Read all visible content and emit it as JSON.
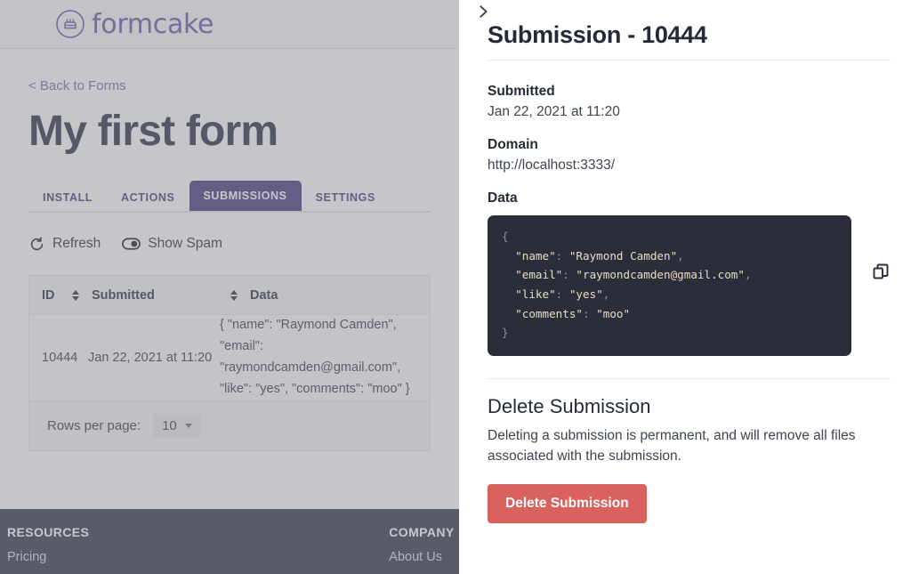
{
  "brand": {
    "name": "formcake",
    "logo_icon": "cake-circle-icon",
    "color": "#6b5ca5"
  },
  "left": {
    "back_link": "< Back to Forms",
    "page_title": "My first form",
    "tabs": [
      {
        "label": "INSTALL",
        "active": false
      },
      {
        "label": "ACTIONS",
        "active": false
      },
      {
        "label": "SUBMISSIONS",
        "active": true
      },
      {
        "label": "SETTINGS",
        "active": false
      }
    ],
    "toolbar": {
      "refresh_label": "Refresh",
      "refresh_icon": "refresh-icon",
      "spam_label": "Show Spam",
      "spam_icon": "toggle-switch-icon"
    },
    "table": {
      "columns": [
        "ID",
        "Submitted",
        "Data"
      ],
      "rows": [
        {
          "id": "10444",
          "submitted": "Jan 22, 2021 at 11:20",
          "data": "{ \"name\": \"Raymond Camden\", \"email\": \"raymondcamden@gmail.com\", \"like\": \"yes\", \"comments\": \"moo\" }"
        }
      ],
      "rows_per_page_label": "Rows per page:",
      "rows_per_page_value": "10"
    },
    "footer": {
      "columns": [
        {
          "title": "RESOURCES",
          "links": [
            "Pricing"
          ]
        },
        {
          "title": "COMPANY",
          "links": [
            "About Us"
          ]
        }
      ]
    }
  },
  "drawer": {
    "close_icon": "chevron-right-icon",
    "title": "Submission - 10444",
    "submitted_label": "Submitted",
    "submitted_value": "Jan 22, 2021 at 11:20",
    "domain_label": "Domain",
    "domain_value": "http://localhost:3333/",
    "data_label": "Data",
    "copy_icon": "copy-icon",
    "code_lines": [
      {
        "text": "{",
        "kind": "punct"
      },
      {
        "key": "\"name\"",
        "sep": ": ",
        "value": "\"Raymond Camden\"",
        "comma": ","
      },
      {
        "key": "\"email\"",
        "sep": ": ",
        "value": "\"raymondcamden@gmail.com\"",
        "comma": ","
      },
      {
        "key": "\"like\"",
        "sep": ": ",
        "value": "\"yes\"",
        "comma": ","
      },
      {
        "key": "\"comments\"",
        "sep": ": ",
        "value": "\"moo\"",
        "comma": ""
      },
      {
        "text": "}",
        "kind": "punct"
      }
    ],
    "delete_title": "Delete Submission",
    "delete_desc": "Deleting a submission is permanent, and will remove all files associated with the submission.",
    "delete_button": "Delete Submission",
    "delete_button_color": "#d9615e"
  }
}
